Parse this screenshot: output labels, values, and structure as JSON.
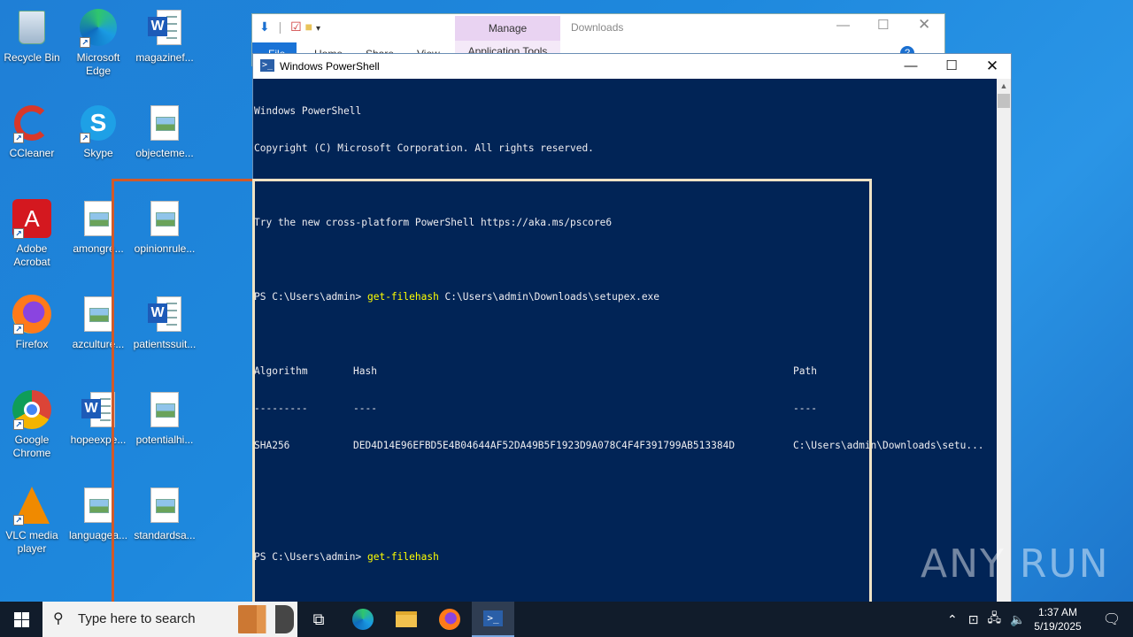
{
  "desktop": {
    "icons": [
      {
        "label": "Recycle Bin"
      },
      {
        "label": "Microsoft Edge"
      },
      {
        "label": "magazinef..."
      },
      {
        "label": "CCleaner"
      },
      {
        "label": "Skype"
      },
      {
        "label": "objecteme..."
      },
      {
        "label": "Adobe Acrobat"
      },
      {
        "label": "amongre..."
      },
      {
        "label": "opinionrule..."
      },
      {
        "label": "Firefox"
      },
      {
        "label": "azculture..."
      },
      {
        "label": "patientssuit..."
      },
      {
        "label": "Google Chrome"
      },
      {
        "label": "hopeexpe..."
      },
      {
        "label": "potentialhi..."
      },
      {
        "label": "VLC media player"
      },
      {
        "label": "languagea..."
      },
      {
        "label": "standardsa..."
      }
    ]
  },
  "explorer": {
    "manage_label": "Manage",
    "app_tools_label": "Application Tools",
    "title": "Downloads",
    "tabs": {
      "file": "File",
      "home": "Home",
      "share": "Share",
      "view": "View"
    }
  },
  "powershell": {
    "title": "Windows PowerShell",
    "lines": {
      "l1": "Windows PowerShell",
      "l2": "Copyright (C) Microsoft Corporation. All rights reserved.",
      "l3": "Try the new cross-platform PowerShell https://aka.ms/pscore6",
      "prompt1": "PS C:\\Users\\admin> ",
      "cmd1": "get-filehash",
      "arg1": " C:\\Users\\admin\\Downloads\\setupex.exe",
      "prompt2": "PS C:\\Users\\admin> ",
      "cmd2": "get-filehash"
    },
    "table": {
      "headers": {
        "algorithm": "Algorithm",
        "hash": "Hash",
        "path": "Path"
      },
      "underlines": {
        "algorithm": "---------",
        "hash": "----",
        "path": "----"
      },
      "row": {
        "algorithm": "SHA256",
        "hash": "DED4D14E96EFBD5E4B04644AF52DA49B5F1923D9A078C4F4F391799AB513384D",
        "path": "C:\\Users\\admin\\Downloads\\setu..."
      }
    }
  },
  "watermark": "ANY RUN",
  "taskbar": {
    "search_placeholder": "Type here to search",
    "time": "1:37 AM",
    "date": "5/19/2025"
  }
}
